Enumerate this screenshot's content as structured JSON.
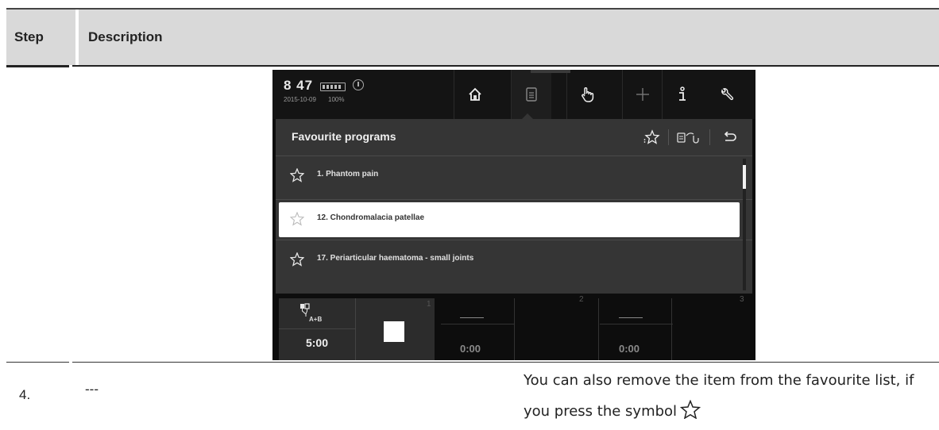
{
  "table": {
    "header": {
      "step": "Step",
      "description": "Description"
    },
    "row4": {
      "step": "4.",
      "description": "---",
      "note": "You can also remove the item from the favourite list, if you press the symbol",
      "note_icon": "star-outline-icon"
    }
  },
  "device": {
    "status": {
      "time": "8 47",
      "date": "2015-10-09",
      "battery": "100%"
    },
    "nav": [
      {
        "icon": "home-icon"
      },
      {
        "icon": "document-icon"
      },
      {
        "icon": "hand-pointer-icon"
      },
      {
        "icon": "plus-icon"
      },
      {
        "icon": "info-icon"
      },
      {
        "icon": "wrench-icon"
      }
    ],
    "panel": {
      "title": "Favourite programs",
      "tools": [
        "favourite-star-icon",
        "program-transfer-icon",
        "back-icon"
      ]
    },
    "programs": [
      {
        "label": "1. Phantom pain",
        "selected": false
      },
      {
        "label": "12. Chondromalacia patellae",
        "selected": true
      },
      {
        "label": "17. Periarticular haematoma - small joints",
        "selected": false
      }
    ],
    "channels": {
      "electrode": "A+B",
      "ch1": {
        "number": "1",
        "time": "5:00"
      },
      "ch2": {
        "number": "2",
        "time": "0:00"
      },
      "ch3": {
        "number": "3",
        "time": "0:00"
      }
    }
  },
  "colors": {
    "screen_bg": "#0d0d0d",
    "panel_bg": "#353535",
    "selected_row": "#ffffff",
    "header_bg": "#d9d9d9"
  }
}
